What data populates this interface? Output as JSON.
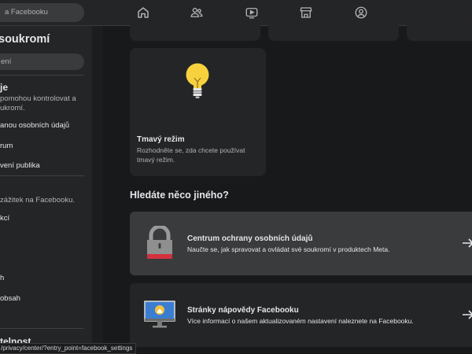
{
  "topbar": {
    "search_text": "a Facebooku",
    "icons": [
      "home-icon",
      "friends-icon",
      "watch-icon",
      "marketplace-icon",
      "profile-icon"
    ]
  },
  "sidebar": {
    "title": "soukromí",
    "search_text": "ení",
    "lines": [
      {
        "text": "je",
        "style": "head"
      },
      {
        "text": "pomohou kontrolovat a",
        "style": "muted"
      },
      {
        "text": "ukromí.",
        "style": "muted"
      },
      {
        "text": "anou osobních údajů",
        "style": "normal"
      },
      {
        "text": "rum",
        "style": "normal"
      },
      {
        "text": "vení publika",
        "style": "normal"
      },
      {
        "text": "zážitek na Facebooku.",
        "style": "muted"
      },
      {
        "text": "kcí",
        "style": "normal"
      },
      {
        "text": "h",
        "style": "normal"
      },
      {
        "text": "obsah",
        "style": "normal"
      },
      {
        "text": "telnost",
        "style": "head"
      }
    ],
    "status_url": "/privacy/center/?entry_point=facebook_settings"
  },
  "dark_mode_card": {
    "title": "Tmavý režim",
    "description": "Rozhodněte se, zda chcete používat tmavý režim."
  },
  "section_heading": "Hledáte něco jiného?",
  "list_cards": [
    {
      "title": "Centrum ochrany osobních údajů",
      "description": "Naučte se, jak spravovat a ovládat své soukromí v produktech Meta.",
      "icon": "padlock-icon"
    },
    {
      "title": "Stránky nápovědy Facebooku",
      "description": "Více informací o našem aktualizovaném nastavení naleznete na Facebooku.",
      "icon": "help-monitor-icon"
    }
  ],
  "colors": {
    "background": "#18191a",
    "surface": "#242526",
    "highlight": "#3a3b3c",
    "bulb": "#f7d23e",
    "lock_red": "#d3313d"
  }
}
